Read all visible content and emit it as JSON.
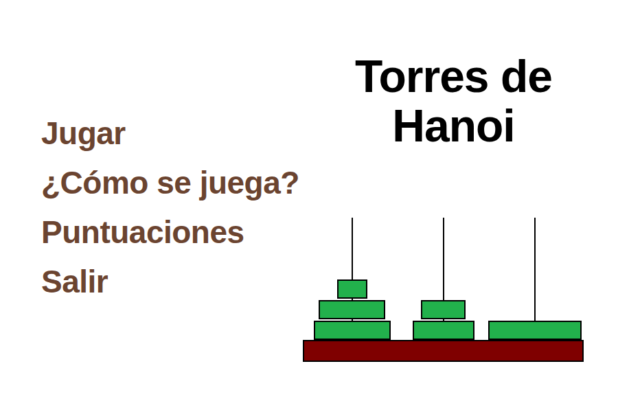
{
  "menu": [
    {
      "label": "Jugar"
    },
    {
      "label": "¿Cómo se juega?"
    },
    {
      "label": "Puntuaciones"
    },
    {
      "label": "Salir"
    }
  ],
  "title": [
    "Torres de",
    "Hanoi"
  ],
  "towers": [
    {
      "disks": [
        {
          "level": 0.32
        },
        {
          "level": 0.71
        },
        {
          "level": 0.82
        }
      ]
    },
    {
      "disks": [
        {
          "level": 0.48
        },
        {
          "level": 0.66
        }
      ]
    },
    {
      "disks": [
        {
          "level": 1.0
        }
      ]
    }
  ]
}
